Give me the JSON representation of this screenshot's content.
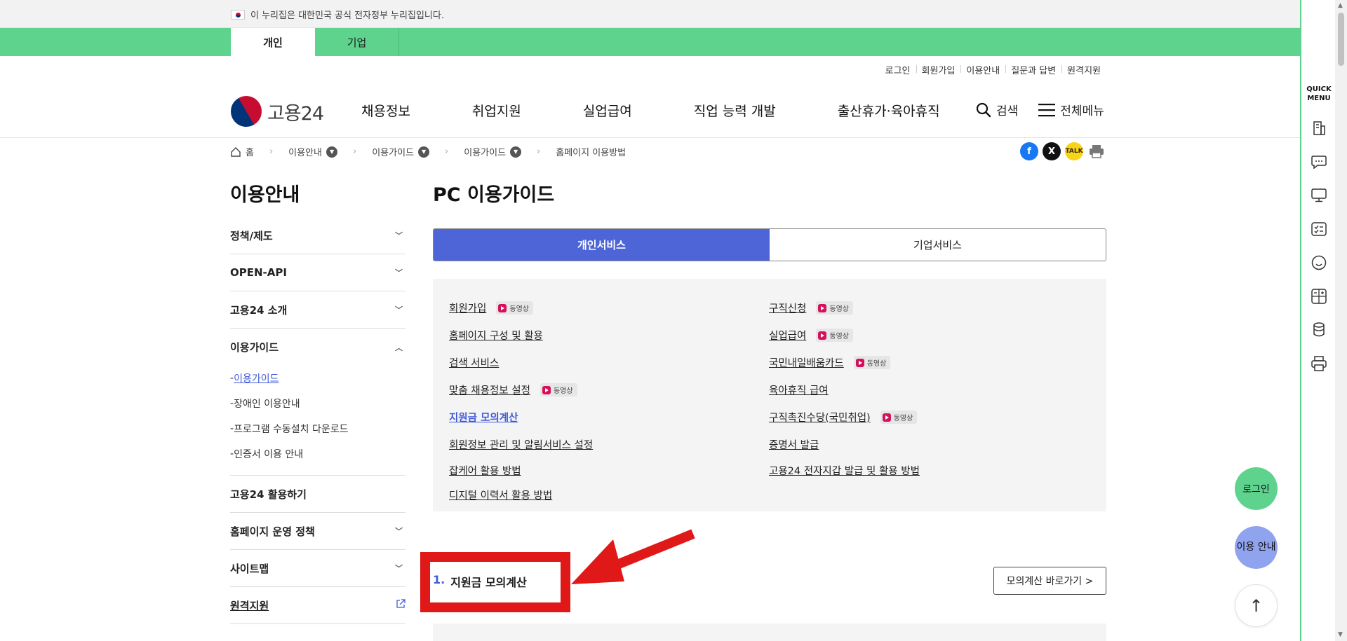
{
  "gov_banner": {
    "text": "이 누리집은 대한민국 공식 전자정부 누리집입니다."
  },
  "user_tabs": [
    {
      "label": "개인"
    },
    {
      "label": "기업"
    }
  ],
  "util_links": [
    "로그인",
    "회원가입",
    "이용안내",
    "질문과 답변",
    "원격지원"
  ],
  "header": {
    "logo_text": "고용24",
    "gnb": [
      "채용정보",
      "취업지원",
      "실업급여",
      "직업 능력 개발",
      "출산휴가·육아휴직"
    ],
    "search_label": "검색",
    "menu_label": "전체메뉴"
  },
  "breadcrumb": {
    "home": "홈",
    "items": [
      "이용안내",
      "이용가이드",
      "이용가이드",
      "홈페이지 이용방법"
    ]
  },
  "share_icons": [
    "facebook-icon",
    "x-icon",
    "kakaotalk-icon",
    "print-icon"
  ],
  "lnb": {
    "title": "이용안내",
    "items": [
      {
        "label": "정책/제도"
      },
      {
        "label": "OPEN-API"
      },
      {
        "label": "고용24 소개"
      },
      {
        "label": "이용가이드",
        "sub": [
          "이용가이드",
          "장애인 이용안내",
          "프로그램 수동설치 다운로드",
          "인증서 이용 안내"
        ]
      },
      {
        "label": "고용24 활용하기"
      },
      {
        "label": "홈페이지 운영 정책"
      },
      {
        "label": "사이트맵"
      },
      {
        "label": "원격지원"
      }
    ]
  },
  "main": {
    "title": "PC 이용가이드",
    "tabs": [
      "개인서비스",
      "기업서비스"
    ],
    "video_badge": "동영상",
    "left_links": [
      {
        "label": "회원가입",
        "video": true
      },
      {
        "label": "홈페이지 구성 및 활용",
        "video": false
      },
      {
        "label": "검색 서비스",
        "video": false
      },
      {
        "label": "맞춤 채용정보 설정",
        "video": true
      },
      {
        "label": "지원금 모의계산",
        "video": false
      },
      {
        "label": "회원정보 관리 및 알림서비스 설정",
        "video": false
      },
      {
        "label": "잡케어 활용 방법",
        "video": false
      },
      {
        "label": "디지털 이력서 활용 방법",
        "video": false
      }
    ],
    "right_links": [
      {
        "label": "구직신청",
        "video": true
      },
      {
        "label": "실업급여",
        "video": true
      },
      {
        "label": "국민내일배움카드",
        "video": true
      },
      {
        "label": "육아휴직 급여",
        "video": false
      },
      {
        "label": "구직촉진수당(국민취업)",
        "video": true
      },
      {
        "label": "증명서 발급",
        "video": false
      },
      {
        "label": "고용24 전자지갑 발급 및 활용 방법",
        "video": false
      }
    ],
    "section": {
      "num": "1.",
      "title": "지원금 모의계산",
      "button": "모의계산 바로가기 >"
    }
  },
  "quick_menu": {
    "title": "QUICK MENU",
    "icons": [
      "building-icon",
      "chat-icon",
      "monitor-icon",
      "checklist-icon",
      "smile-icon",
      "calculator-icon",
      "coins-icon",
      "printer-icon"
    ]
  },
  "floating": {
    "login": "로그인",
    "guide": "이용 안내",
    "top": "↑"
  },
  "colors": {
    "green": "#5dd38e",
    "blue": "#4e65d7",
    "link_blue": "#3f5bd8",
    "red": "#e01818"
  }
}
